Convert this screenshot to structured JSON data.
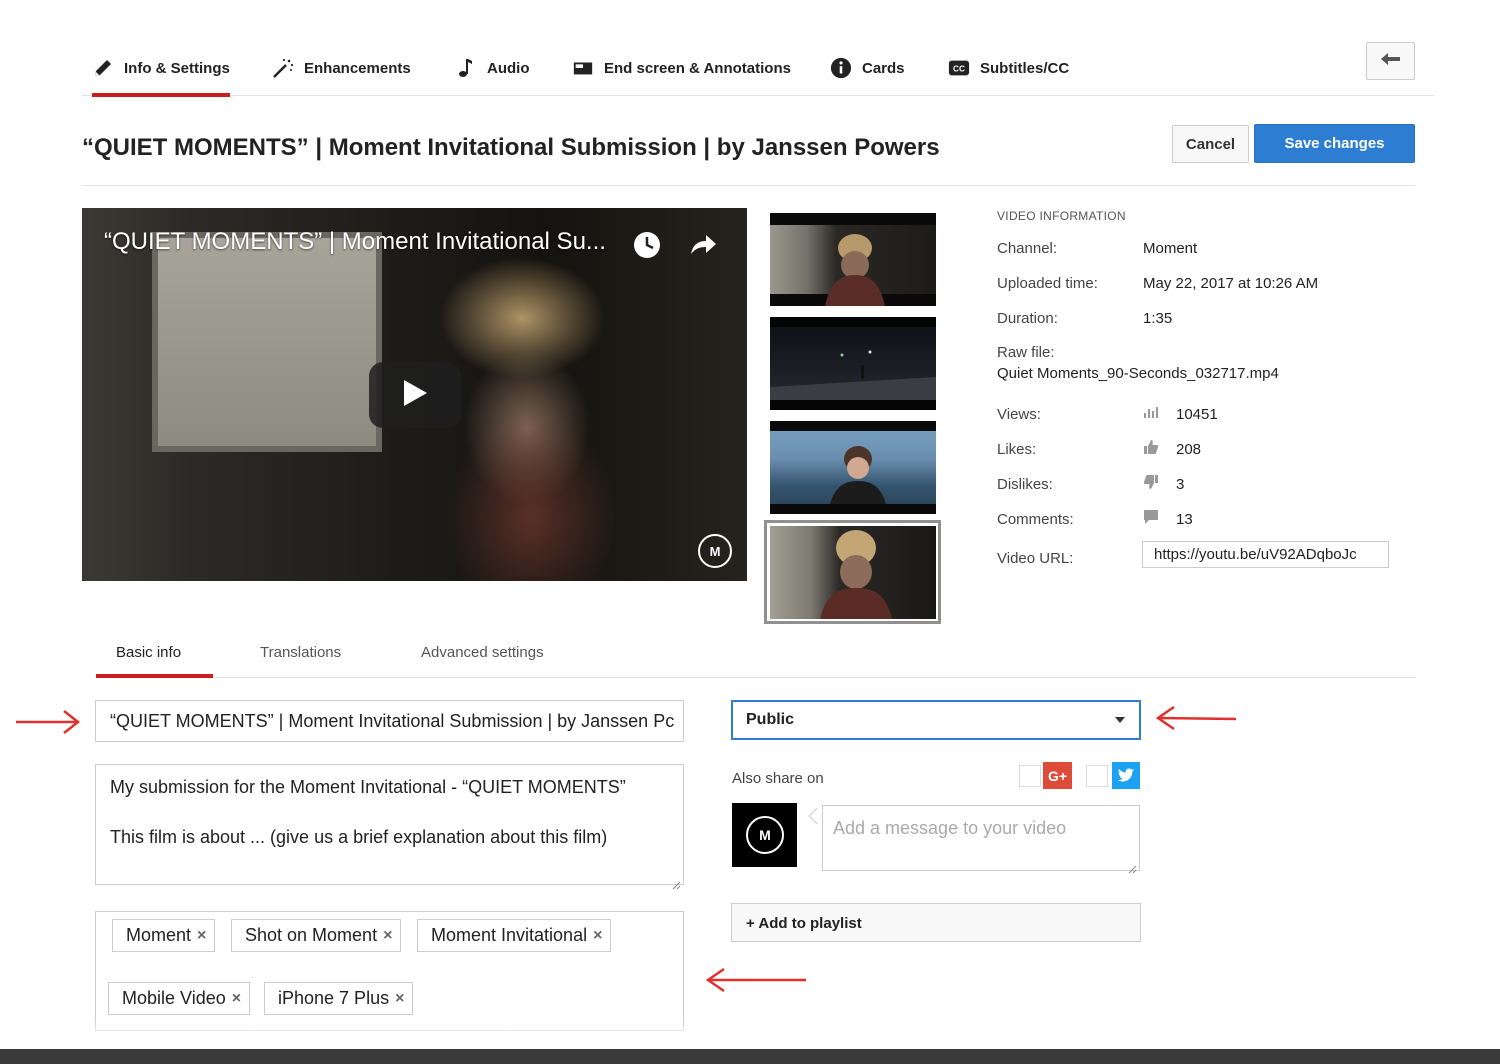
{
  "tabs": [
    {
      "label": "Info & Settings",
      "icon": "pencil-icon"
    },
    {
      "label": "Enhancements",
      "icon": "magic-wand-icon"
    },
    {
      "label": "Audio",
      "icon": "music-note-icon"
    },
    {
      "label": "End screen & Annotations",
      "icon": "end-screen-icon"
    },
    {
      "label": "Cards",
      "icon": "info-icon"
    },
    {
      "label": "Subtitles/CC",
      "icon": "cc-icon"
    }
  ],
  "page_title": "“QUIET MOMENTS” | Moment Invitational Submission | by Janssen Powers",
  "actions": {
    "cancel": "Cancel",
    "save": "Save changes"
  },
  "player": {
    "title": "“QUIET MOMENTS” | Moment Invitational Su..."
  },
  "video_info": {
    "heading": "VIDEO INFORMATION",
    "channel_label": "Channel:",
    "channel": "Moment",
    "uploaded_label": "Uploaded time:",
    "uploaded": "May 22, 2017 at 10:26 AM",
    "duration_label": "Duration:",
    "duration": "1:35",
    "raw_label": "Raw file:",
    "raw_file": "Quiet Moments_90-Seconds_032717.mp4",
    "views_label": "Views:",
    "views": "10451",
    "likes_label": "Likes:",
    "likes": "208",
    "dislikes_label": "Dislikes:",
    "dislikes": "3",
    "comments_label": "Comments:",
    "comments": "13",
    "url_label": "Video URL:",
    "url": "https://youtu.be/uV92ADqboJc"
  },
  "subtabs": [
    "Basic info",
    "Translations",
    "Advanced settings"
  ],
  "form": {
    "title_value": "“QUIET MOMENTS” | Moment Invitational Submission | by Janssen Pc",
    "desc_line1": "My submission for the Moment Invitational - “QUIET MOMENTS”",
    "desc_line2": "This film is about ... (give us a brief explanation about this film)",
    "tags": [
      "Moment",
      "Shot on Moment",
      "Moment Invitational",
      "Mobile Video",
      "iPhone 7 Plus"
    ],
    "tag_remove": "×",
    "privacy": "Public",
    "share_label": "Also share on",
    "gplus_label": "G+",
    "message_placeholder": "Add a message to your video",
    "playlist_label": "+ Add to playlist"
  },
  "colors": {
    "accent_red": "#cc1e1e",
    "primary_blue": "#2d7dd2",
    "annotation_arrow": "#e0312f"
  }
}
